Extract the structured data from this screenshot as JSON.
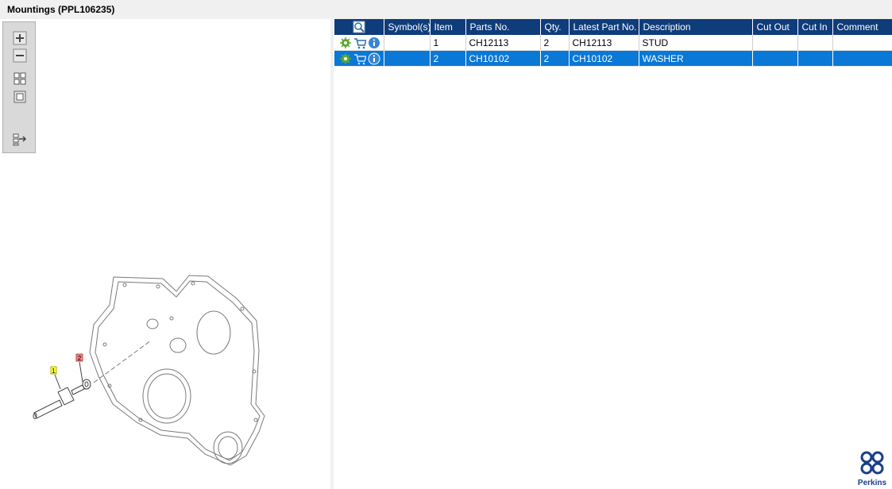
{
  "window": {
    "title": "Mountings (PPL106235)"
  },
  "toolbox": {
    "icons": [
      "zoom-in-icon",
      "zoom-out-icon",
      "fit-all-icon",
      "fit-window-icon",
      "export-icon"
    ]
  },
  "drawing": {
    "callouts": [
      "1",
      "2"
    ],
    "callout_colors": {
      "1": "#ffff33",
      "2": "#f08080"
    }
  },
  "table": {
    "headers": [
      "",
      "Symbol(s)",
      "Item",
      "Parts No.",
      "Qty.",
      "Latest Part No.",
      "Description",
      "Cut Out",
      "Cut In",
      "Comment"
    ],
    "rows": [
      {
        "symbol": "",
        "item": "1",
        "part_no": "CH12113",
        "qty": "2",
        "latest_part_no": "CH12113",
        "description": "STUD",
        "cut_out": "",
        "cut_in": "",
        "comment": "",
        "selected": false
      },
      {
        "symbol": "",
        "item": "2",
        "part_no": "CH10102",
        "qty": "2",
        "latest_part_no": "CH10102",
        "description": "WASHER",
        "cut_out": "",
        "cut_in": "",
        "comment": "",
        "selected": true
      }
    ]
  },
  "colors": {
    "header_bg": "#0f3c7a",
    "selected_row": "#0a78d7",
    "brand": "#1a3e8c"
  },
  "logo": {
    "text": "Perkins"
  }
}
